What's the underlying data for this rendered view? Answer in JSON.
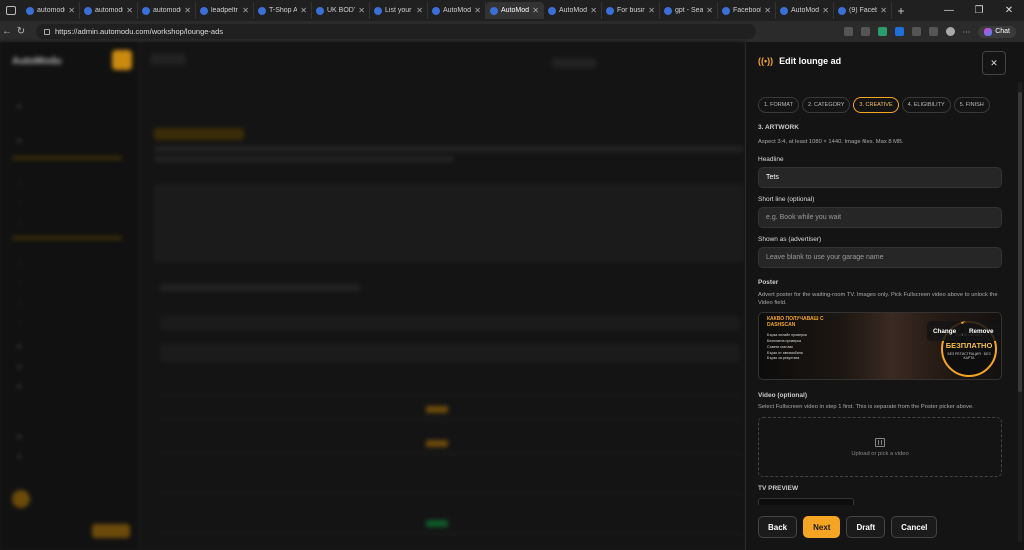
{
  "browser": {
    "tabs": [
      {
        "title": "automodu"
      },
      {
        "title": "automodu"
      },
      {
        "title": "automodu"
      },
      {
        "title": "leadpeltr"
      },
      {
        "title": "T-Shop A"
      },
      {
        "title": "UK BODY"
      },
      {
        "title": "List your"
      },
      {
        "title": "AutoModu"
      },
      {
        "title": "AutoModu",
        "active": true
      },
      {
        "title": "AutoModu"
      },
      {
        "title": "For busine"
      },
      {
        "title": "gpt - Sea"
      },
      {
        "title": "Facebook"
      },
      {
        "title": "AutoModi"
      },
      {
        "title": "(9) Facebo"
      }
    ],
    "url": "https://admin.automodu.com/workshop/lounge-ads",
    "chat_label": "Chat"
  },
  "panel": {
    "title": "Edit lounge ad",
    "steps": [
      "1. FORMAT",
      "2. CATEGORY",
      "3. CREATIVE",
      "4. ELIGIBILITY",
      "5. FINISH"
    ],
    "active_step": 2,
    "section_title": "3. ARTWORK",
    "section_help": "Aspect 3:4, at least 1080 × 1440. Image files. Max 8 MB.",
    "headline": {
      "label": "Headline",
      "value": "Tets"
    },
    "short_line": {
      "label": "Short line (optional)",
      "placeholder": "e.g. Book while you wait"
    },
    "shown_as": {
      "label": "Shown as (advertiser)",
      "placeholder": "Leave blank to use your garage name"
    },
    "poster": {
      "label": "Poster",
      "help": "Advert poster for the waiting-room TV. Images only. Pick Fullscreen video above to unlock the Video field.",
      "change": "Change",
      "remove": "Remove",
      "image_headline": "КАКВО ПОЛУЧАВАШ С DASHSCAN",
      "image_items": [
        "Бърза онлайн проверка",
        "Безплатна проверка",
        "Съвети към вас",
        "Бързо от автомобила",
        "Бързо за резултата"
      ],
      "image_badge_top": "ТЪРСИ ОНЛАЙН",
      "image_badge": "БЕЗПЛАТНО",
      "image_badge_sub": "БЕЗ РЕГИСТРАЦИЯ · БЕЗ КАРТА"
    },
    "video": {
      "label": "Video (optional)",
      "help": "Select Fullscreen video in step 1 first. This is separate from the Poster picker above.",
      "upload": "Upload or pick a video"
    },
    "tv_preview": "TV PREVIEW",
    "buttons": {
      "back": "Back",
      "next": "Next",
      "draft": "Draft",
      "cancel": "Cancel"
    }
  },
  "colors": {
    "accent": "#f5a524",
    "panel_bg": "#141414"
  }
}
